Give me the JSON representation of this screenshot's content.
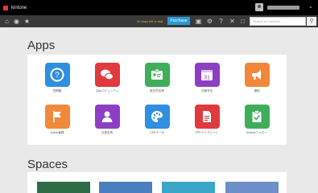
{
  "app": {
    "name": "kintone"
  },
  "toolbar": {
    "trial_text": "30 days left in trial",
    "purchase_label": "Purchase",
    "search_placeholder": "Search all contents"
  },
  "apps": {
    "heading": "Apps",
    "items": [
      {
        "label": "質問箱",
        "icon": "question-icon",
        "color": "#2f8fe0"
      },
      {
        "label": "Q&Aコミュニティ",
        "icon": "chat-bubbles-icon",
        "color": "#e0393e"
      },
      {
        "label": "取引先名簿",
        "icon": "contact-card-icon",
        "color": "#3fae5a"
      },
      {
        "label": "日報予定",
        "icon": "calendar-icon",
        "color": "#8d3fc4"
      },
      {
        "label": "通知",
        "icon": "megaphone-icon",
        "color": "#f1873b"
      },
      {
        "label": "Action管理",
        "icon": "flag-icon",
        "color": "#f08a3a"
      },
      {
        "label": "社員名簿",
        "icon": "person-icon",
        "color": "#8d3fc4"
      },
      {
        "label": "CSSデータ",
        "icon": "palette-icon",
        "color": "#2f8fe0"
      },
      {
        "label": "PPTテンプレート",
        "icon": "document-icon",
        "color": "#e0393e"
      },
      {
        "label": "kintoneフォロー",
        "icon": "clipboard-check-icon",
        "color": "#3fae5a"
      }
    ]
  },
  "spaces": {
    "heading": "Spaces",
    "items": [
      {
        "name": "space-thumb-forest",
        "color": "#2e6b47"
      },
      {
        "name": "space-thumb-blue",
        "color": "#4a7fc0"
      },
      {
        "name": "space-thumb-sea",
        "color": "#3aa6c8"
      },
      {
        "name": "space-thumb-flag",
        "color": "#6d8fc9"
      }
    ]
  }
}
